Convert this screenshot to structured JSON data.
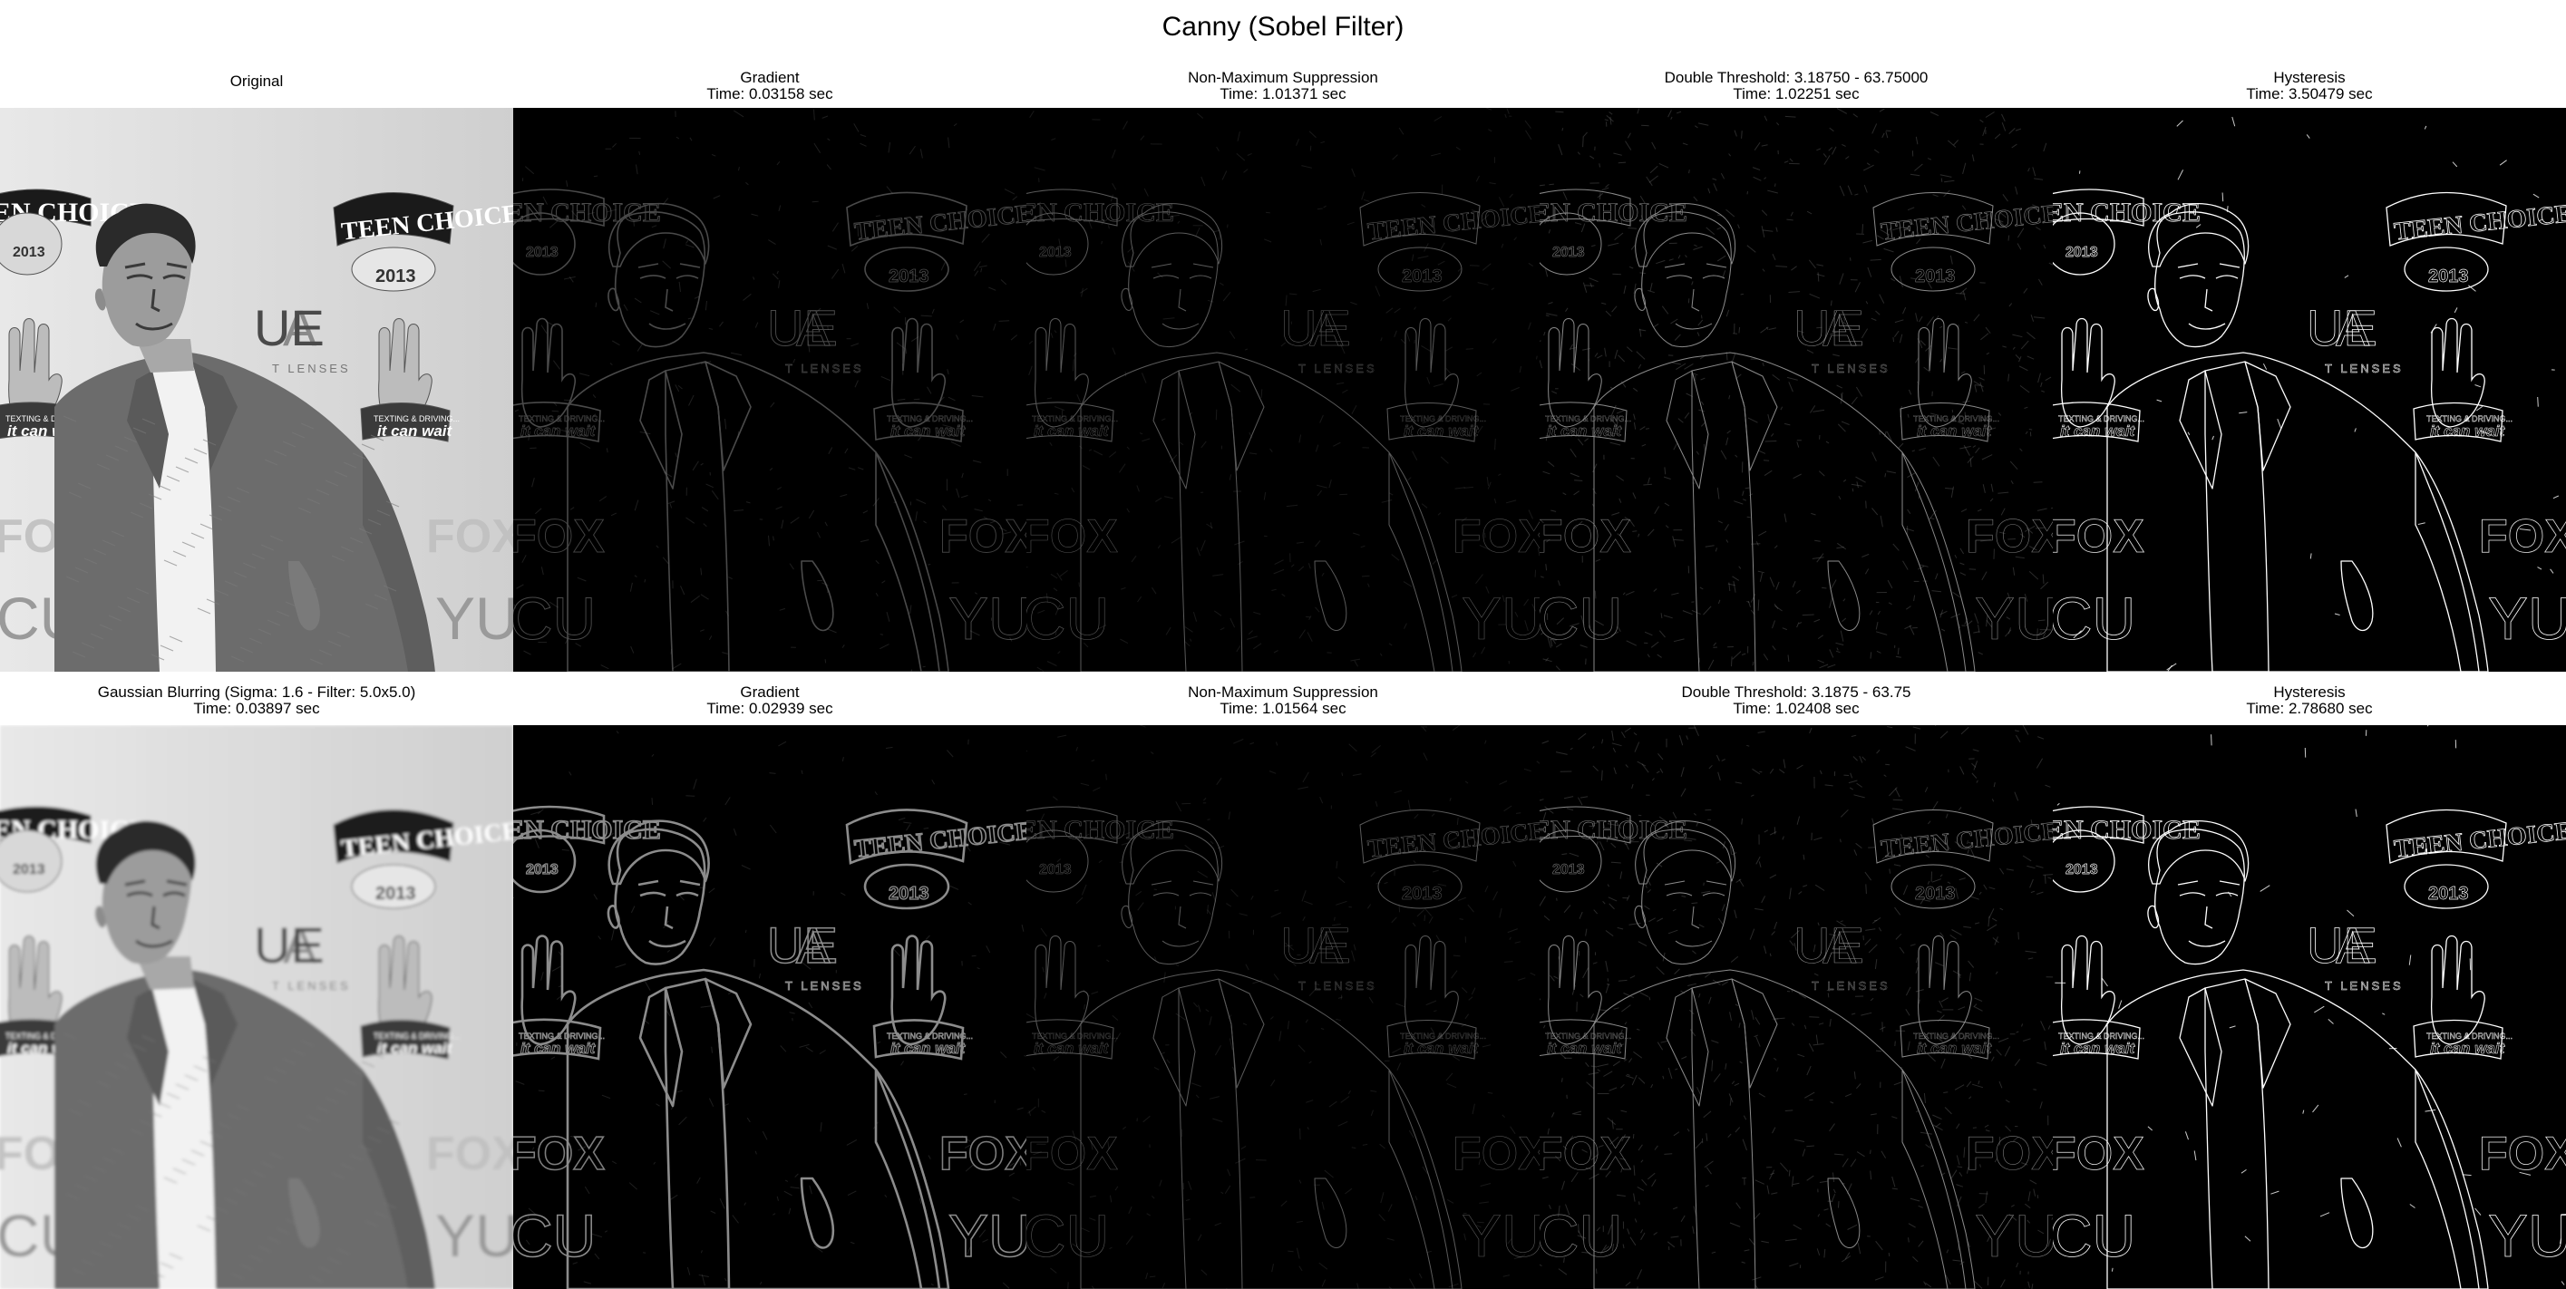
{
  "figure": {
    "title": "Canny (Sobel Filter)"
  },
  "rows": [
    {
      "panels": [
        {
          "id": "orig",
          "kind": "photo",
          "title": "Original",
          "time": ""
        },
        {
          "id": "grad1",
          "kind": "gradient",
          "title": "Gradient",
          "time": "Time: 0.03158 sec"
        },
        {
          "id": "nms1",
          "kind": "nms",
          "title": "Non-Maximum Suppression",
          "time": "Time: 1.01371 sec"
        },
        {
          "id": "dt1",
          "kind": "threshold",
          "title": "Double Threshold: 3.18750 - 63.75000",
          "time": "Time: 1.02251 sec"
        },
        {
          "id": "hys1",
          "kind": "hysteresis",
          "title": "Hysteresis",
          "time": "Time: 3.50479 sec"
        }
      ]
    },
    {
      "panels": [
        {
          "id": "blur",
          "kind": "photo-blur",
          "title": "Gaussian Blurring (Sigma: 1.6 - Filter: 5.0x5.0)",
          "time": "Time: 0.03897 sec"
        },
        {
          "id": "grad2",
          "kind": "gradient-strong",
          "title": "Gradient",
          "time": "Time: 0.02939 sec"
        },
        {
          "id": "nms2",
          "kind": "nms",
          "title": "Non-Maximum Suppression",
          "time": "Time: 1.01564 sec"
        },
        {
          "id": "dt2",
          "kind": "threshold",
          "title": "Double Threshold: 3.1875 - 63.75",
          "time": "Time: 1.02408 sec"
        },
        {
          "id": "hys2",
          "kind": "hysteresis",
          "title": "Hysteresis",
          "time": "Time: 2.78680 sec"
        }
      ]
    }
  ],
  "scene_text": {
    "teen_choice": "TEEN CHOICE",
    "year": "2013",
    "left_badge": "EN CHOICE",
    "brand": "UE",
    "brand_prefix": "A",
    "brand_sub": "T LENSES",
    "hand_line1": "TEXTING & DRIVING...",
    "hand_line2": "it can wait",
    "fox": "FOX",
    "cu_left": "CU",
    "yu_right": "YU"
  }
}
